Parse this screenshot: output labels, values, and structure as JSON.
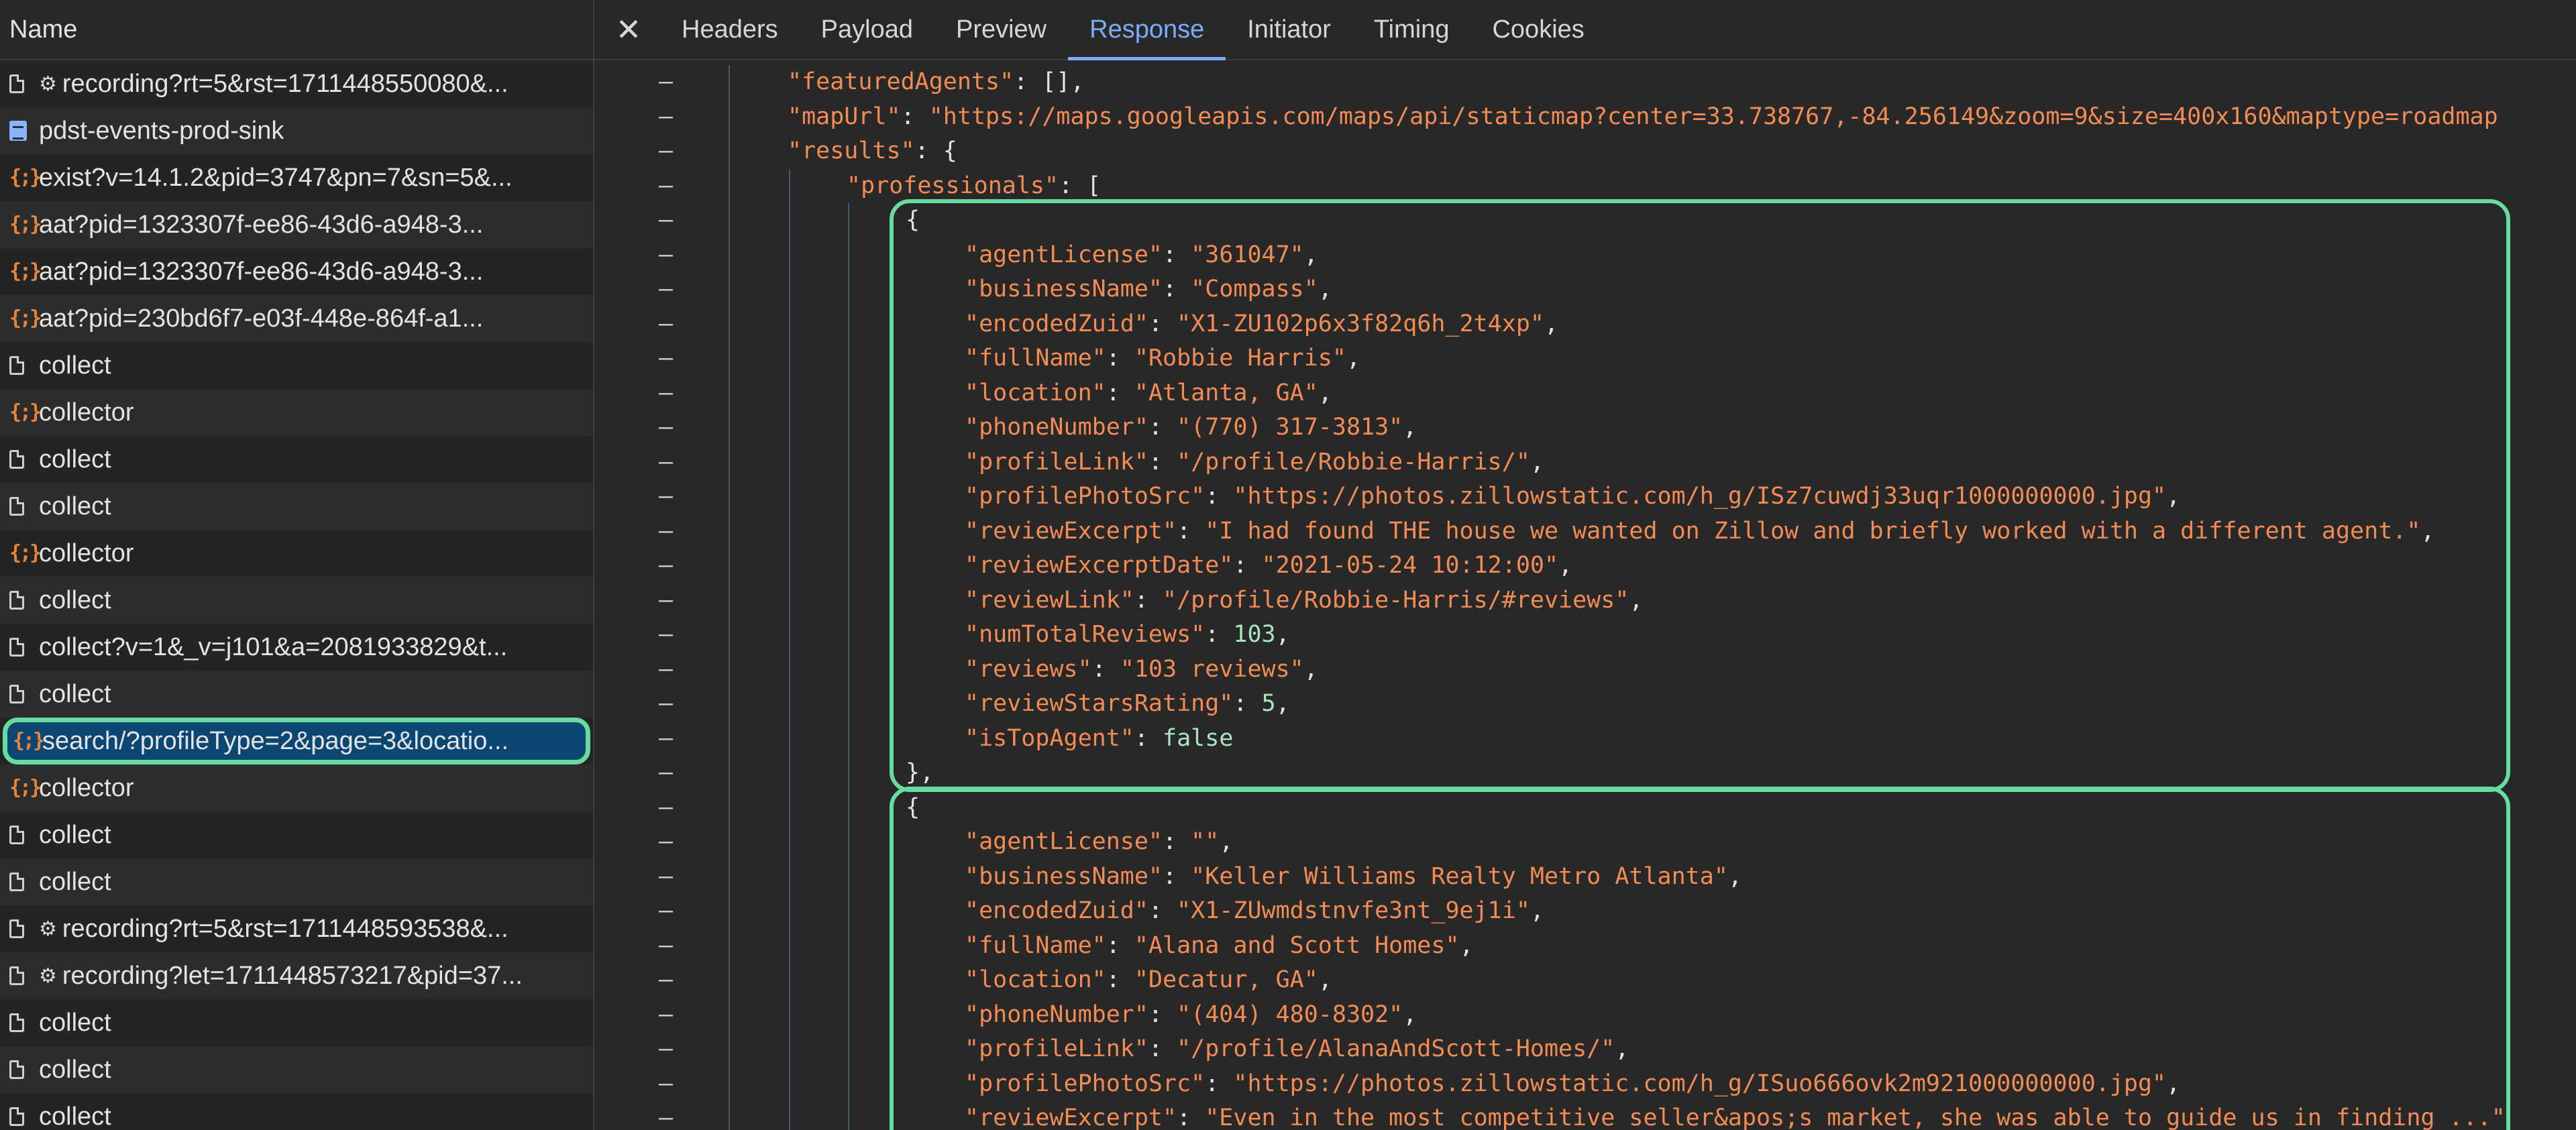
{
  "left_panel": {
    "header": "Name",
    "requests": [
      {
        "name": "recording?rt=5&rst=1711448550080&...",
        "icon": "doc-icon",
        "gear": true
      },
      {
        "name": "pdst-events-prod-sink",
        "icon": "list-icon",
        "gear": false
      },
      {
        "name": "exist?v=14.1.2&pid=3747&pn=7&sn=5&...",
        "icon": "json-icon",
        "gear": false
      },
      {
        "name": "aat?pid=1323307f-ee86-43d6-a948-3...",
        "icon": "json-icon",
        "gear": false
      },
      {
        "name": "aat?pid=1323307f-ee86-43d6-a948-3...",
        "icon": "json-icon",
        "gear": false
      },
      {
        "name": "aat?pid=230bd6f7-e03f-448e-864f-a1...",
        "icon": "json-icon",
        "gear": false
      },
      {
        "name": "collect",
        "icon": "doc-icon",
        "gear": false
      },
      {
        "name": "collector",
        "icon": "json-icon",
        "gear": false
      },
      {
        "name": "collect",
        "icon": "doc-icon",
        "gear": false
      },
      {
        "name": "collect",
        "icon": "doc-icon",
        "gear": false
      },
      {
        "name": "collector",
        "icon": "json-icon",
        "gear": false
      },
      {
        "name": "collect",
        "icon": "doc-icon",
        "gear": false
      },
      {
        "name": "collect?v=1&_v=j101&a=2081933829&t...",
        "icon": "doc-icon",
        "gear": false
      },
      {
        "name": "collect",
        "icon": "doc-icon",
        "gear": false
      },
      {
        "name": "search/?profileType=2&page=3&locatio...",
        "icon": "json-icon",
        "gear": false,
        "selected": true
      },
      {
        "name": "collector",
        "icon": "json-icon",
        "gear": false
      },
      {
        "name": "collect",
        "icon": "doc-icon",
        "gear": false
      },
      {
        "name": "collect",
        "icon": "doc-icon",
        "gear": false
      },
      {
        "name": "recording?rt=5&rst=1711448593538&...",
        "icon": "doc-icon",
        "gear": true
      },
      {
        "name": "recording?let=1711448573217&pid=37...",
        "icon": "doc-icon",
        "gear": true
      },
      {
        "name": "collect",
        "icon": "doc-icon",
        "gear": false
      },
      {
        "name": "collect",
        "icon": "doc-icon",
        "gear": false
      },
      {
        "name": "collect",
        "icon": "doc-icon",
        "gear": false
      }
    ]
  },
  "tabs": {
    "close_icon": "close-icon",
    "items": [
      {
        "label": "Headers",
        "active": false
      },
      {
        "label": "Payload",
        "active": false
      },
      {
        "label": "Preview",
        "active": false
      },
      {
        "label": "Response",
        "active": true
      },
      {
        "label": "Initiator",
        "active": false
      },
      {
        "label": "Timing",
        "active": false
      },
      {
        "label": "Cookies",
        "active": false
      }
    ]
  },
  "response": {
    "fold_marker": "–",
    "lines": [
      {
        "indent": 1,
        "parts": [
          [
            "k",
            "\"featuredAgents\""
          ],
          [
            "p",
            ": [],"
          ]
        ]
      },
      {
        "indent": 1,
        "parts": [
          [
            "k",
            "\"mapUrl\""
          ],
          [
            "p",
            ": "
          ],
          [
            "s",
            "\"https://maps.googleapis.com/maps/api/staticmap?center=33.738767,-84.256149&zoom=9&size=400x160&maptype=roadmap"
          ]
        ]
      },
      {
        "indent": 1,
        "parts": [
          [
            "k",
            "\"results\""
          ],
          [
            "p",
            ": {"
          ]
        ]
      },
      {
        "indent": 2,
        "parts": [
          [
            "k",
            "\"professionals\""
          ],
          [
            "p",
            ": ["
          ]
        ]
      },
      {
        "indent": 3,
        "parts": [
          [
            "p",
            "{"
          ]
        ]
      },
      {
        "indent": 4,
        "parts": [
          [
            "k",
            "\"agentLicense\""
          ],
          [
            "p",
            ": "
          ],
          [
            "s",
            "\"361047\""
          ],
          [
            "p",
            ","
          ]
        ]
      },
      {
        "indent": 4,
        "parts": [
          [
            "k",
            "\"businessName\""
          ],
          [
            "p",
            ": "
          ],
          [
            "s",
            "\"Compass\""
          ],
          [
            "p",
            ","
          ]
        ]
      },
      {
        "indent": 4,
        "parts": [
          [
            "k",
            "\"encodedZuid\""
          ],
          [
            "p",
            ": "
          ],
          [
            "s",
            "\"X1-ZU102p6x3f82q6h_2t4xp\""
          ],
          [
            "p",
            ","
          ]
        ]
      },
      {
        "indent": 4,
        "parts": [
          [
            "k",
            "\"fullName\""
          ],
          [
            "p",
            ": "
          ],
          [
            "s",
            "\"Robbie Harris\""
          ],
          [
            "p",
            ","
          ]
        ]
      },
      {
        "indent": 4,
        "parts": [
          [
            "k",
            "\"location\""
          ],
          [
            "p",
            ": "
          ],
          [
            "s",
            "\"Atlanta, GA\""
          ],
          [
            "p",
            ","
          ]
        ]
      },
      {
        "indent": 4,
        "parts": [
          [
            "k",
            "\"phoneNumber\""
          ],
          [
            "p",
            ": "
          ],
          [
            "s",
            "\"(770) 317-3813\""
          ],
          [
            "p",
            ","
          ]
        ]
      },
      {
        "indent": 4,
        "parts": [
          [
            "k",
            "\"profileLink\""
          ],
          [
            "p",
            ": "
          ],
          [
            "s",
            "\"/profile/Robbie-Harris/\""
          ],
          [
            "p",
            ","
          ]
        ]
      },
      {
        "indent": 4,
        "parts": [
          [
            "k",
            "\"profilePhotoSrc\""
          ],
          [
            "p",
            ": "
          ],
          [
            "s",
            "\"https://photos.zillowstatic.com/h_g/ISz7cuwdj33uqr1000000000.jpg\""
          ],
          [
            "p",
            ","
          ]
        ]
      },
      {
        "indent": 4,
        "parts": [
          [
            "k",
            "\"reviewExcerpt\""
          ],
          [
            "p",
            ": "
          ],
          [
            "s",
            "\"I had found THE house we wanted on Zillow and briefly worked with a different agent.\""
          ],
          [
            "p",
            ","
          ]
        ]
      },
      {
        "indent": 4,
        "parts": [
          [
            "k",
            "\"reviewExcerptDate\""
          ],
          [
            "p",
            ": "
          ],
          [
            "s",
            "\"2021-05-24 10:12:00\""
          ],
          [
            "p",
            ","
          ]
        ]
      },
      {
        "indent": 4,
        "parts": [
          [
            "k",
            "\"reviewLink\""
          ],
          [
            "p",
            ": "
          ],
          [
            "s",
            "\"/profile/Robbie-Harris/#reviews\""
          ],
          [
            "p",
            ","
          ]
        ]
      },
      {
        "indent": 4,
        "parts": [
          [
            "k",
            "\"numTotalReviews\""
          ],
          [
            "p",
            ": "
          ],
          [
            "n",
            "103"
          ],
          [
            "p",
            ","
          ]
        ]
      },
      {
        "indent": 4,
        "parts": [
          [
            "k",
            "\"reviews\""
          ],
          [
            "p",
            ": "
          ],
          [
            "s",
            "\"103 reviews\""
          ],
          [
            "p",
            ","
          ]
        ]
      },
      {
        "indent": 4,
        "parts": [
          [
            "k",
            "\"reviewStarsRating\""
          ],
          [
            "p",
            ": "
          ],
          [
            "n",
            "5"
          ],
          [
            "p",
            ","
          ]
        ]
      },
      {
        "indent": 4,
        "parts": [
          [
            "k",
            "\"isTopAgent\""
          ],
          [
            "p",
            ": "
          ],
          [
            "b",
            "false"
          ]
        ]
      },
      {
        "indent": 3,
        "parts": [
          [
            "p",
            "},"
          ]
        ]
      },
      {
        "indent": 3,
        "parts": [
          [
            "p",
            "{"
          ]
        ]
      },
      {
        "indent": 4,
        "parts": [
          [
            "k",
            "\"agentLicense\""
          ],
          [
            "p",
            ": "
          ],
          [
            "s",
            "\"\""
          ],
          [
            "p",
            ","
          ]
        ]
      },
      {
        "indent": 4,
        "parts": [
          [
            "k",
            "\"businessName\""
          ],
          [
            "p",
            ": "
          ],
          [
            "s",
            "\"Keller Williams Realty Metro Atlanta\""
          ],
          [
            "p",
            ","
          ]
        ]
      },
      {
        "indent": 4,
        "parts": [
          [
            "k",
            "\"encodedZuid\""
          ],
          [
            "p",
            ": "
          ],
          [
            "s",
            "\"X1-ZUwmdstnvfe3nt_9ej1i\""
          ],
          [
            "p",
            ","
          ]
        ]
      },
      {
        "indent": 4,
        "parts": [
          [
            "k",
            "\"fullName\""
          ],
          [
            "p",
            ": "
          ],
          [
            "s",
            "\"Alana and Scott Homes\""
          ],
          [
            "p",
            ","
          ]
        ]
      },
      {
        "indent": 4,
        "parts": [
          [
            "k",
            "\"location\""
          ],
          [
            "p",
            ": "
          ],
          [
            "s",
            "\"Decatur, GA\""
          ],
          [
            "p",
            ","
          ]
        ]
      },
      {
        "indent": 4,
        "parts": [
          [
            "k",
            "\"phoneNumber\""
          ],
          [
            "p",
            ": "
          ],
          [
            "s",
            "\"(404) 480-8302\""
          ],
          [
            "p",
            ","
          ]
        ]
      },
      {
        "indent": 4,
        "parts": [
          [
            "k",
            "\"profileLink\""
          ],
          [
            "p",
            ": "
          ],
          [
            "s",
            "\"/profile/AlanaAndScott-Homes/\""
          ],
          [
            "p",
            ","
          ]
        ]
      },
      {
        "indent": 4,
        "parts": [
          [
            "k",
            "\"profilePhotoSrc\""
          ],
          [
            "p",
            ": "
          ],
          [
            "s",
            "\"https://photos.zillowstatic.com/h_g/ISuo666ovk2m921000000000.jpg\""
          ],
          [
            "p",
            ","
          ]
        ]
      },
      {
        "indent": 4,
        "parts": [
          [
            "k",
            "\"reviewExcerpt\""
          ],
          [
            "p",
            ": "
          ],
          [
            "s",
            "\"Even in the most competitive seller&apos;s market, she was able to guide us in finding ...\""
          ]
        ]
      }
    ]
  },
  "colors": {
    "highlight": "#66dca0",
    "selected_row": "#0c4672",
    "active_tab": "#7cacf8",
    "json_key": "#f28b54",
    "json_number": "#a8e6c2"
  }
}
